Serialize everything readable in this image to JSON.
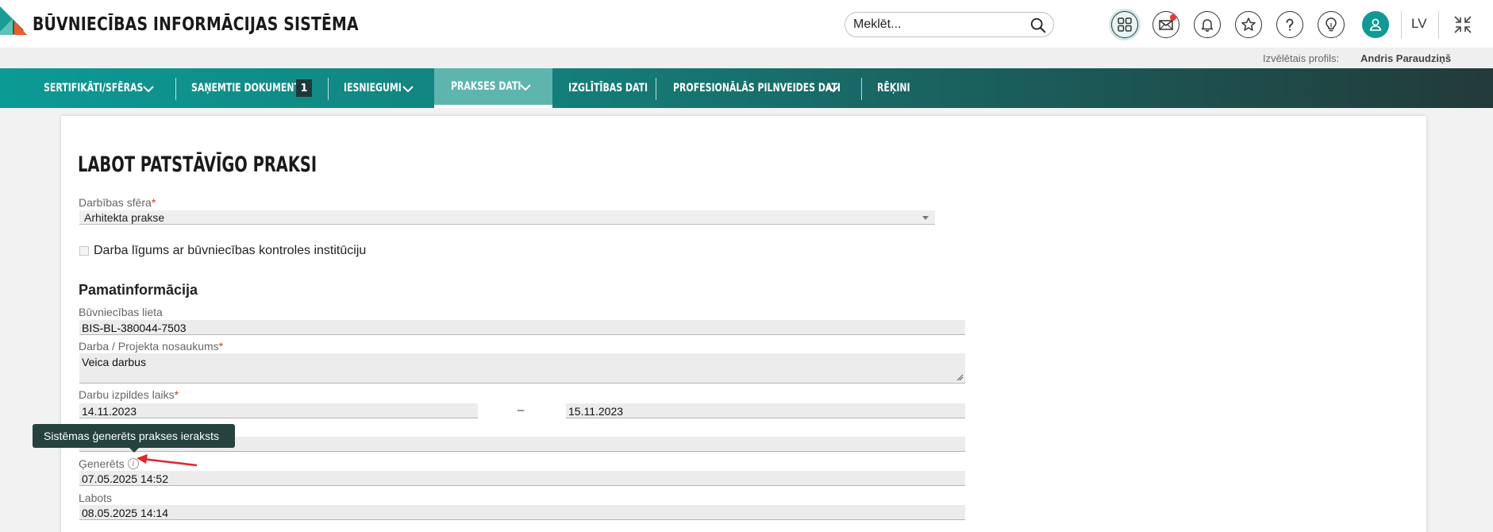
{
  "header": {
    "brand_title": "BŪVNIECĪBAS INFORMĀCIJAS SISTĒMA",
    "search_placeholder": "Meklēt...",
    "language": "LV"
  },
  "profile": {
    "label": "Izvēlētais profils:",
    "name": "Andris Paraudziņš"
  },
  "nav": {
    "items": [
      {
        "label": "SERTIFIKĀTI/SFĒRAS",
        "has_dropdown": true
      },
      {
        "label": "SAŅEMTIE DOKUMENTI",
        "badge": "1"
      },
      {
        "label": "IESNIEGUMI",
        "has_dropdown": true
      },
      {
        "label": "PRAKSES DATI",
        "has_dropdown": true,
        "active": true
      },
      {
        "label": "IZGLĪTĪBAS DATI"
      },
      {
        "label": "PROFESIONĀLĀS PILNVEIDES DATI",
        "has_dropdown": true
      },
      {
        "label": "RĒĶINI"
      }
    ]
  },
  "form": {
    "title": "LABOT PATSTĀVĪGO PRAKSI",
    "sphere_label": "Darbības sfēra",
    "sphere_value": "Arhitekta prakse",
    "contract_checkbox_label": "Darba līgums ar būvniecības kontroles institūciju",
    "section_title": "Pamatinformācija",
    "case_label": "Būvniecības lieta",
    "case_value": "BIS-BL-380044-7503",
    "project_name_label": "Darba / Projekta nosaukums",
    "project_name_value": "Veica darbus",
    "period_label": "Darbu izpildes laiks",
    "period_from": "14.11.2023",
    "period_separator": "–",
    "period_to": "15.11.2023",
    "generated_label": "Ģenerēts",
    "generated_value": "07.05.2025 14:52",
    "edited_label": "Labots",
    "edited_value": "08.05.2025 14:14",
    "required_mark": "*"
  },
  "tooltip": {
    "text": "Sistēmas ģenerēts prakses ieraksts"
  },
  "colors": {
    "teal": "#0c9a95",
    "nav_dark": "#223a39",
    "tooltip_bg": "#25423f",
    "required": "#c0392b",
    "annotation_arrow": "#e0262b"
  }
}
